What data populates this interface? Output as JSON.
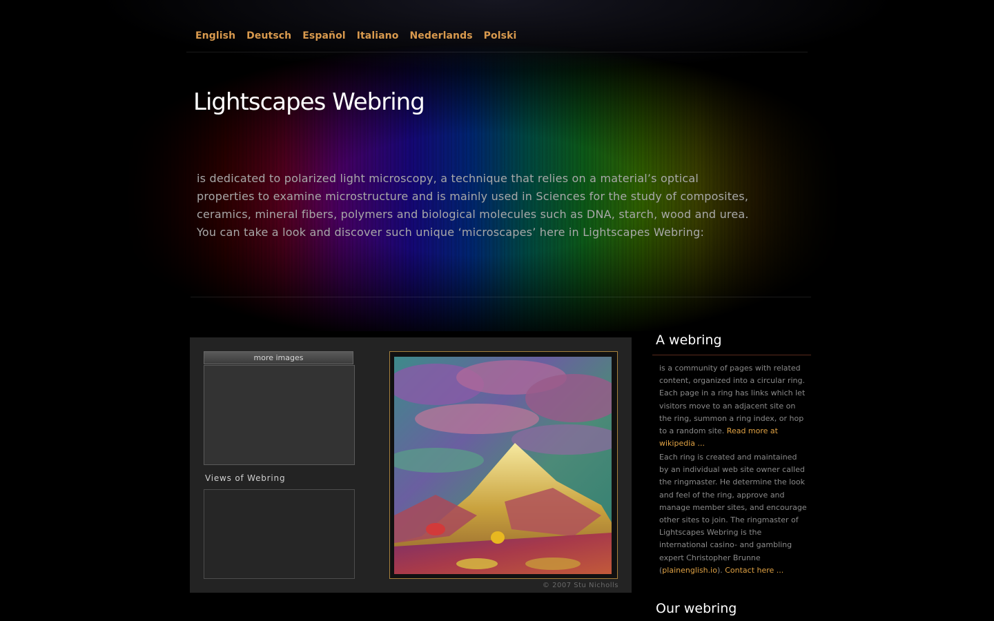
{
  "nav": {
    "languages": [
      "English",
      "Deutsch",
      "Español",
      "Italiano",
      "Nederlands",
      "Polski"
    ]
  },
  "header": {
    "title": "Lightscapes Webring",
    "intro": "is dedicated to polarized light microscopy, a technique that relies on a material’s optical properties to examine microstructure and is mainly used in Sciences for the study of composites, ceramics, mineral fibers, polymers and biological molecules such as DNA, starch, wood and urea. You can take a look and discover such unique ‘microscapes’ here in Lightscapes Webring:"
  },
  "gallery": {
    "thumbs_header": "more images",
    "views_label": "Views of Webring",
    "copyright": "© 2007 Stu Nicholls"
  },
  "sidebar": {
    "section1_title": "A webring",
    "p1_text": "is a community of pages with related content, organized into a circular ring. Each page in a ring has links which let visitors move to an adjacent site on the ring, summon a ring index, or hop to a random site. ",
    "p1_link": "Read more at wikipedia ...",
    "p2_text": "Each ring is created and maintained by an individual web site owner called the ringmaster. He determine the look and feel of the ring, approve and manage member sites, and encourage other sites to join. The ringmaster of Lightscapes Webring is the international casino- and gambling expert Christopher Brunne (",
    "p2_link1": "plainenglish.io",
    "p2_mid": "). ",
    "p2_link2": "Contact here ...",
    "section2_title": "Our webring"
  },
  "colors": {
    "accent": "#d99a4e",
    "link": "#e0a244",
    "background": "#000000",
    "panel": "#232323",
    "frame_border": "#a8823c"
  }
}
